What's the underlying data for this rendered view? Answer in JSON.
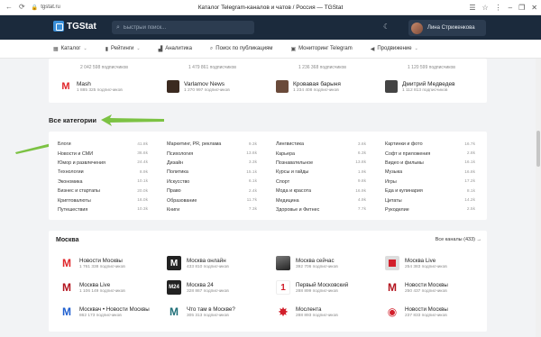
{
  "browser": {
    "url": "tgstat.ru",
    "tab_title": "Каталог Telegram-каналов и чатов / Россия — TGStat"
  },
  "header": {
    "logo": "TGStat",
    "search_placeholder": "Быстрый поиск...",
    "user_name": "Лина Стриженкова"
  },
  "nav": [
    {
      "icon": "grid-icon",
      "label": "Каталог"
    },
    {
      "icon": "chart-icon",
      "label": "Рейтинги"
    },
    {
      "icon": "analytics-icon",
      "label": "Аналитика"
    },
    {
      "icon": "search-icon",
      "label": "Поиск по публикациям"
    },
    {
      "icon": "monitor-icon",
      "label": "Мониторинг Telegram"
    },
    {
      "icon": "megaphone-icon",
      "label": "Продвижение"
    }
  ],
  "top_channels": {
    "row1_subs": [
      "2 042 598 подписчиков",
      "1 479 861 подписчиков",
      "1 236 368 подписчиков",
      "1 120 599 подписчиков"
    ],
    "row2": [
      {
        "name": "Mash",
        "subs": "1 885 325 подписчиков",
        "color": "#ffffff"
      },
      {
        "name": "Varlamov News",
        "subs": "1 270 997 подписчиков",
        "color": "#3b2a20"
      },
      {
        "name": "Кровавая барыня",
        "subs": "1 234 408 подписчиков",
        "color": "#6a4a3a"
      },
      {
        "name": "Дмитрий Медведев",
        "subs": "1 112 813 подписчиков",
        "color": "#444444"
      }
    ]
  },
  "categories": {
    "heading": "Все категории",
    "columns": [
      [
        {
          "label": "Блоги",
          "count": "41.8k"
        },
        {
          "label": "Новости и СМИ",
          "count": "36.6k"
        },
        {
          "label": "Юмор и развлечения",
          "count": "24.4k"
        },
        {
          "label": "Технологии",
          "count": "8.9k"
        },
        {
          "label": "Экономика",
          "count": "10.1k"
        },
        {
          "label": "Бизнес и стартапы",
          "count": "20.0k"
        },
        {
          "label": "Криптовалюты",
          "count": "16.0k"
        },
        {
          "label": "Путешествия",
          "count": "10.3k"
        }
      ],
      [
        {
          "label": "Маркетинг, PR, реклама",
          "count": "9.3k"
        },
        {
          "label": "Психология",
          "count": "13.6k"
        },
        {
          "label": "Дизайн",
          "count": "3.3k"
        },
        {
          "label": "Политика",
          "count": "15.1k"
        },
        {
          "label": "Искусство",
          "count": "6.1k"
        },
        {
          "label": "Право",
          "count": "2.4k"
        },
        {
          "label": "Образование",
          "count": "11.7k"
        },
        {
          "label": "Книги",
          "count": "7.3k"
        }
      ],
      [
        {
          "label": "Лингвистика",
          "count": "3.6k"
        },
        {
          "label": "Карьера",
          "count": "6.3k"
        },
        {
          "label": "Познавательное",
          "count": "13.8k"
        },
        {
          "label": "Курсы и гайды",
          "count": "1.9k"
        },
        {
          "label": "Спорт",
          "count": "9.8k"
        },
        {
          "label": "Мода и красота",
          "count": "16.9k"
        },
        {
          "label": "Медицина",
          "count": "4.9k"
        },
        {
          "label": "Здоровье и Фитнес",
          "count": "7.7k"
        }
      ],
      [
        {
          "label": "Картинки и фото",
          "count": "16.7k"
        },
        {
          "label": "Софт и приложения",
          "count": "2.8k"
        },
        {
          "label": "Видео и фильмы",
          "count": "16.1k"
        },
        {
          "label": "Музыка",
          "count": "16.8k"
        },
        {
          "label": "Игры",
          "count": "17.2k"
        },
        {
          "label": "Еда и кулинария",
          "count": "8.1k"
        },
        {
          "label": "Цитаты",
          "count": "14.2k"
        },
        {
          "label": "Рукоделие",
          "count": "2.5k"
        }
      ]
    ]
  },
  "moscow": {
    "title": "Москва",
    "all_link": "Все каналы (433) →",
    "channels": [
      [
        {
          "name": "Новости Москвы",
          "subs": "1 761 338 подписчиков",
          "icon": "mash-m"
        },
        {
          "name": "Москва онлайн",
          "subs": "433 810 подписчиков",
          "icon": "m-dark"
        },
        {
          "name": "Москва сейчас",
          "subs": "392 706 подписчиков",
          "icon": "photo"
        },
        {
          "name": "Москва Live",
          "subs": "254 383 подписчиков",
          "icon": "live"
        }
      ],
      [
        {
          "name": "Москва Live",
          "subs": "1 106 149 подписчиков",
          "icon": "live-m"
        },
        {
          "name": "Москва 24",
          "subs": "328 867 подписчиков",
          "icon": "m24"
        },
        {
          "name": "Первый Московский",
          "subs": "288 899 подписчиков",
          "icon": "first"
        },
        {
          "name": "Новости Москвы",
          "subs": "250 437 подписчиков",
          "icon": "news-m"
        }
      ],
      [
        {
          "name": "Москвач • Новости Москвы",
          "subs": "862 173 подписчиков",
          "icon": "moskvach"
        },
        {
          "name": "Что там в Москве?",
          "subs": "305 313 подписчиков",
          "icon": "m-teal"
        },
        {
          "name": "Мослента",
          "subs": "288 893 подписчиков",
          "icon": "moslenta"
        },
        {
          "name": "Новости Москвы",
          "subs": "237 833 подписчиков",
          "icon": "news-r"
        }
      ]
    ]
  }
}
